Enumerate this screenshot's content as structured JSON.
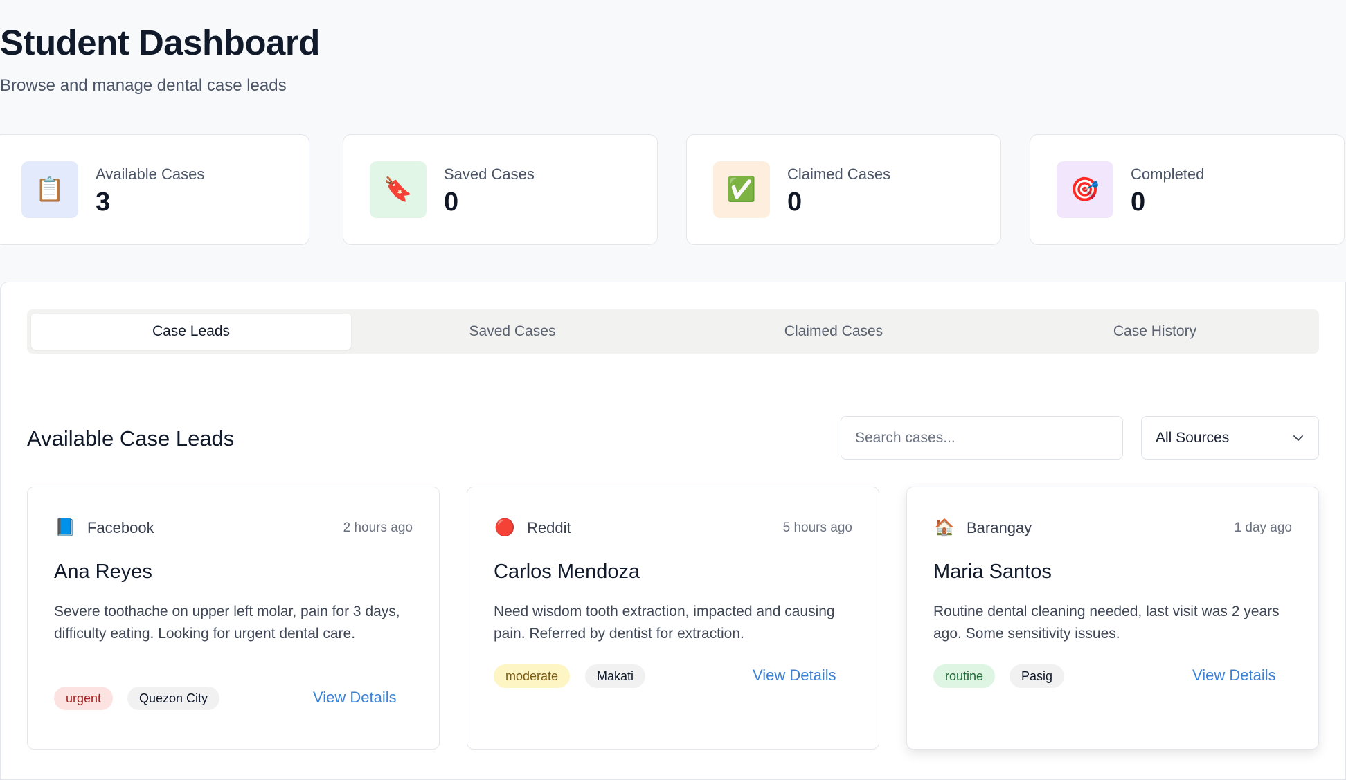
{
  "header": {
    "title": "Student Dashboard",
    "subtitle": "Browse and manage dental case leads"
  },
  "stats": [
    {
      "label": "Available Cases",
      "value": "3",
      "icon": "clipboard-icon",
      "glyph": "📋",
      "tint": "#e3eafc"
    },
    {
      "label": "Saved Cases",
      "value": "0",
      "icon": "bookmark-tag-icon",
      "glyph": "🔖",
      "tint": "#e2f6e8"
    },
    {
      "label": "Claimed Cases",
      "value": "0",
      "icon": "checkmark-icon",
      "glyph": "✅",
      "tint": "#fdeedd"
    },
    {
      "label": "Completed",
      "value": "0",
      "icon": "target-icon",
      "glyph": "🎯",
      "tint": "#f1e6fb"
    }
  ],
  "tabs": [
    {
      "label": "Case Leads",
      "active": true
    },
    {
      "label": "Saved Cases",
      "active": false
    },
    {
      "label": "Claimed Cases",
      "active": false
    },
    {
      "label": "Case History",
      "active": false
    }
  ],
  "leads": {
    "title": "Available Case Leads",
    "search_placeholder": "Search cases...",
    "filter_value": "All Sources"
  },
  "cases": [
    {
      "source": "Facebook",
      "source_icon": "facebook-book-icon",
      "glyph": "📘",
      "time": "2 hours ago",
      "name": "Ana Reyes",
      "description": "Severe toothache on upper left molar, pain for 3 days, difficulty eating. Looking for urgent dental care.",
      "urgency": "urgent",
      "urgency_bg": "#fde2e2",
      "urgency_fg": "#a32020",
      "location": "Quezon City",
      "action": "View Details"
    },
    {
      "source": "Reddit",
      "source_icon": "reddit-dot-icon",
      "glyph": "🔴",
      "time": "5 hours ago",
      "name": "Carlos Mendoza",
      "description": "Need wisdom tooth extraction, impacted and causing pain. Referred by dentist for extraction.",
      "urgency": "moderate",
      "urgency_bg": "#fdf5c4",
      "urgency_fg": "#7a5a12",
      "location": "Makati",
      "action": "View Details"
    },
    {
      "source": "Barangay",
      "source_icon": "house-icon",
      "glyph": "🏠",
      "time": "1 day ago",
      "name": "Maria Santos",
      "description": "Routine dental cleaning needed, last visit was 2 years ago. Some sensitivity issues.",
      "urgency": "routine",
      "urgency_bg": "#dff5e3",
      "urgency_fg": "#1d6b35",
      "location": "Pasig",
      "action": "View Details"
    }
  ]
}
